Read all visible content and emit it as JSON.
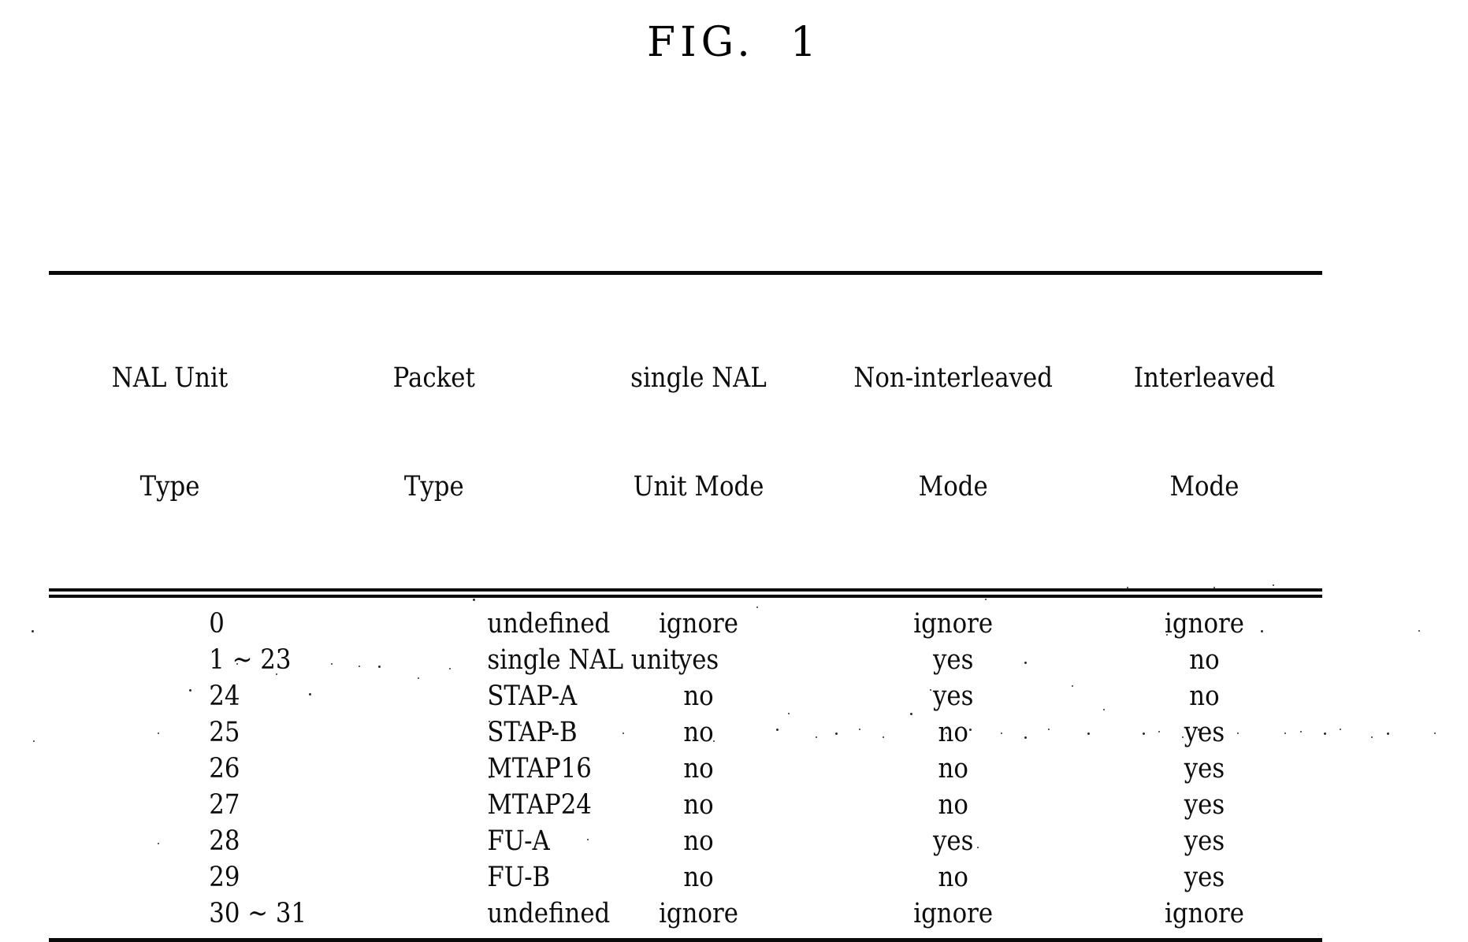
{
  "figure": {
    "title": "FIG.  1"
  },
  "table": {
    "columns": [
      {
        "id": "nal_unit_type",
        "line1": "NAL Unit",
        "line2": "Type"
      },
      {
        "id": "packet_type",
        "line1": "Packet",
        "line2": "Type"
      },
      {
        "id": "single_nal_mode",
        "line1": "single NAL",
        "line2": "Unit Mode"
      },
      {
        "id": "non_interleaved",
        "line1": "Non-interleaved",
        "line2": "Mode"
      },
      {
        "id": "interleaved",
        "line1": "Interleaved",
        "line2": "Mode"
      }
    ],
    "rows": [
      {
        "nal_unit_type": "0",
        "packet_type": "undefined",
        "single_nal_mode": "ignore",
        "non_interleaved": "ignore",
        "interleaved": "ignore"
      },
      {
        "nal_unit_type": "1 ~ 23",
        "packet_type": "single NAL unit",
        "single_nal_mode": "yes",
        "non_interleaved": "yes",
        "interleaved": "no"
      },
      {
        "nal_unit_type": "24",
        "packet_type": "STAP-A",
        "single_nal_mode": "no",
        "non_interleaved": "yes",
        "interleaved": "no"
      },
      {
        "nal_unit_type": "25",
        "packet_type": "STAP-B",
        "single_nal_mode": "no",
        "non_interleaved": "no",
        "interleaved": "yes"
      },
      {
        "nal_unit_type": "26",
        "packet_type": "MTAP16",
        "single_nal_mode": "no",
        "non_interleaved": "no",
        "interleaved": "yes"
      },
      {
        "nal_unit_type": "27",
        "packet_type": "MTAP24",
        "single_nal_mode": "no",
        "non_interleaved": "no",
        "interleaved": "yes"
      },
      {
        "nal_unit_type": "28",
        "packet_type": "FU-A",
        "single_nal_mode": "no",
        "non_interleaved": "yes",
        "interleaved": "yes"
      },
      {
        "nal_unit_type": "29",
        "packet_type": "FU-B",
        "single_nal_mode": "no",
        "non_interleaved": "no",
        "interleaved": "yes"
      },
      {
        "nal_unit_type": "30 ~ 31",
        "packet_type": "undefined",
        "single_nal_mode": "ignore",
        "non_interleaved": "ignore",
        "interleaved": "ignore"
      }
    ]
  },
  "colors": {
    "ink": "#000000",
    "page": "#ffffff"
  }
}
